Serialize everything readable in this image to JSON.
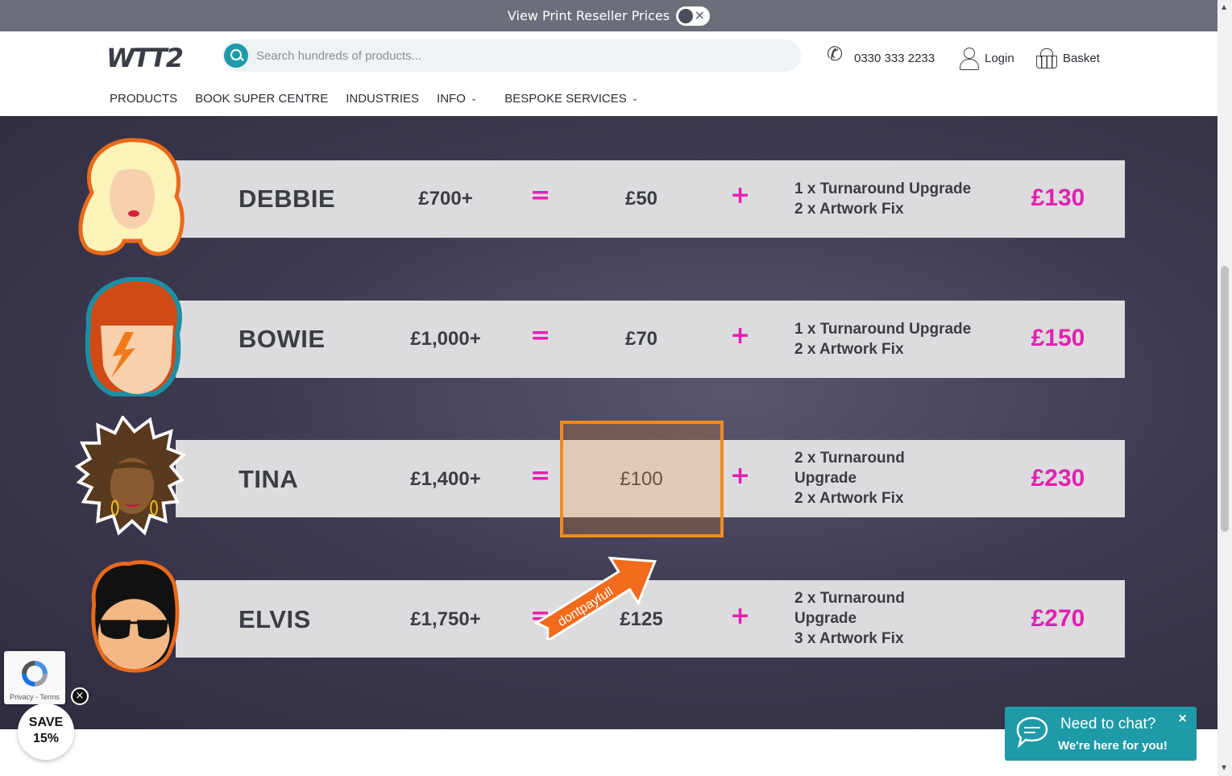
{
  "topbar": {
    "label": "View Print Reseller Prices",
    "toggle_state": "off"
  },
  "header": {
    "logo": "WTT2",
    "search_placeholder": "Search hundreds of products...",
    "phone": "0330 333 2233",
    "login": "Login",
    "basket": "Basket"
  },
  "nav": [
    {
      "label": "PRODUCTS"
    },
    {
      "label": "BOOK SUPER CENTRE"
    },
    {
      "label": "INDUSTRIES"
    },
    {
      "label": "INFO"
    },
    {
      "label": "BESPOKE SERVICES"
    }
  ],
  "symbols": {
    "equals": "=",
    "plus": "+"
  },
  "tiers": [
    {
      "name": "DEBBIE",
      "spend": "£700+",
      "cost": "£50",
      "extras": [
        "1 x Turnaround Upgrade",
        "2 x Artwork Fix"
      ],
      "value": "£130"
    },
    {
      "name": "BOWIE",
      "spend": "£1,000+",
      "cost": "£70",
      "extras": [
        "1 x Turnaround Upgrade",
        "2 x Artwork Fix"
      ],
      "value": "£150"
    },
    {
      "name": "TINA",
      "spend": "£1,400+",
      "cost": "£100",
      "extras": [
        "2 x Turnaround",
        "Upgrade",
        "2 x Artwork Fix"
      ],
      "value": "£230"
    },
    {
      "name": "ELVIS",
      "spend": "£1,750+",
      "cost": "£125",
      "extras": [
        "2 x Turnaround",
        "Upgrade",
        "3 x Artwork Fix"
      ],
      "value": "£270"
    }
  ],
  "arrow_label": "dontpayfull",
  "recaptcha": {
    "text": "Privacy - Terms"
  },
  "save_badge": {
    "line1": "SAVE",
    "line2": "15%"
  },
  "chat": {
    "title": "Need to chat?",
    "subtitle": "We're here for you!",
    "close": "×"
  },
  "colors": {
    "accent_pink": "#e520b0",
    "teal": "#1e9aa8",
    "highlight_orange": "#f28a20"
  }
}
